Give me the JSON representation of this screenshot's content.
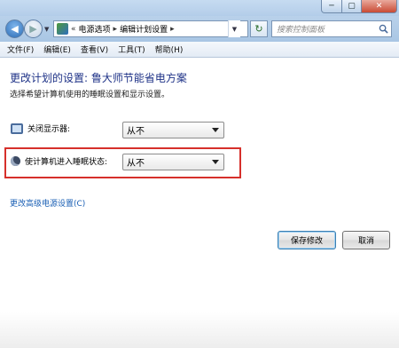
{
  "window": {
    "buttons": {
      "minimize": "─",
      "maximize": "▢",
      "close": "✕"
    }
  },
  "nav": {
    "back_glyph": "◀",
    "forward_glyph": "▶",
    "breadcrumb_prefix": "«",
    "breadcrumb": [
      "电源选项",
      "编辑计划设置"
    ],
    "separator": "▸",
    "refresh_glyph": "↻",
    "search_placeholder": "搜索控制面板"
  },
  "menu": {
    "items": [
      "文件(F)",
      "编辑(E)",
      "查看(V)",
      "工具(T)",
      "帮助(H)"
    ]
  },
  "main": {
    "heading": "更改计划的设置: 鲁大师节能省电方案",
    "subtext": "选择希望计算机使用的睡眠设置和显示设置。",
    "settings": [
      {
        "label": "关闭显示器:",
        "value": "从不",
        "icon": "monitor-icon"
      },
      {
        "label": "使计算机进入睡眠状态:",
        "value": "从不",
        "icon": "sleep-moon-icon"
      }
    ],
    "advanced_link": "更改高级电源设置(C)",
    "save_label": "保存修改",
    "cancel_label": "取消"
  },
  "colors": {
    "heading": "#1e3287",
    "link": "#1a5fb4",
    "highlight_border": "#d6302b"
  }
}
